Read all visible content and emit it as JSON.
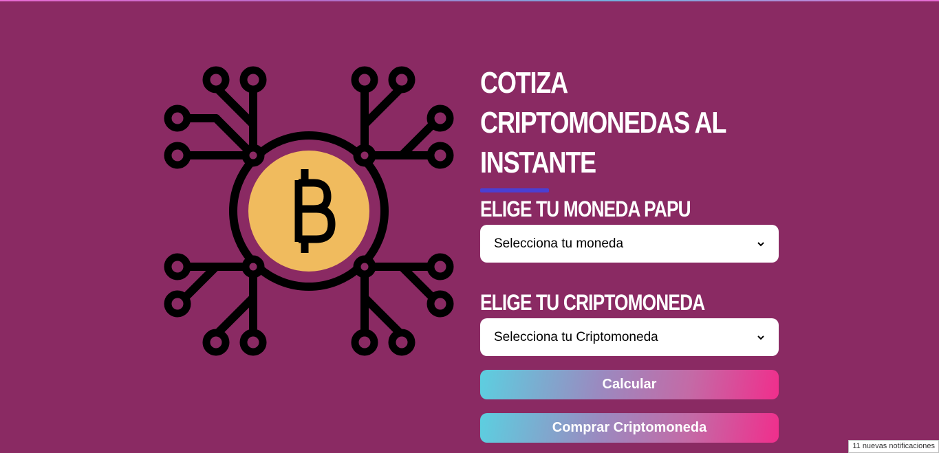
{
  "heading": {
    "title": "Cotiza Criptomonedas al Instante"
  },
  "form": {
    "currency_label": "Elige tu Moneda Papu",
    "currency_select_value": "Selecciona tu moneda",
    "crypto_label": "Elige tu Criptomoneda",
    "crypto_select_value": "Selecciona tu Criptomoneda",
    "calculate_button": "Calcular",
    "buy_button": "Comprar Criptomoneda"
  },
  "illustration": {
    "icon": "bitcoin-network-icon",
    "symbol": "฿"
  },
  "status": {
    "notifications": "11 nuevas notificaciones"
  },
  "colors": {
    "background": "#8a2a63",
    "accent_underline": "#4a3fd4",
    "coin": "#f0bb5e",
    "button_gradient_start": "#5ccfe0",
    "button_gradient_end": "#f02e8c"
  }
}
